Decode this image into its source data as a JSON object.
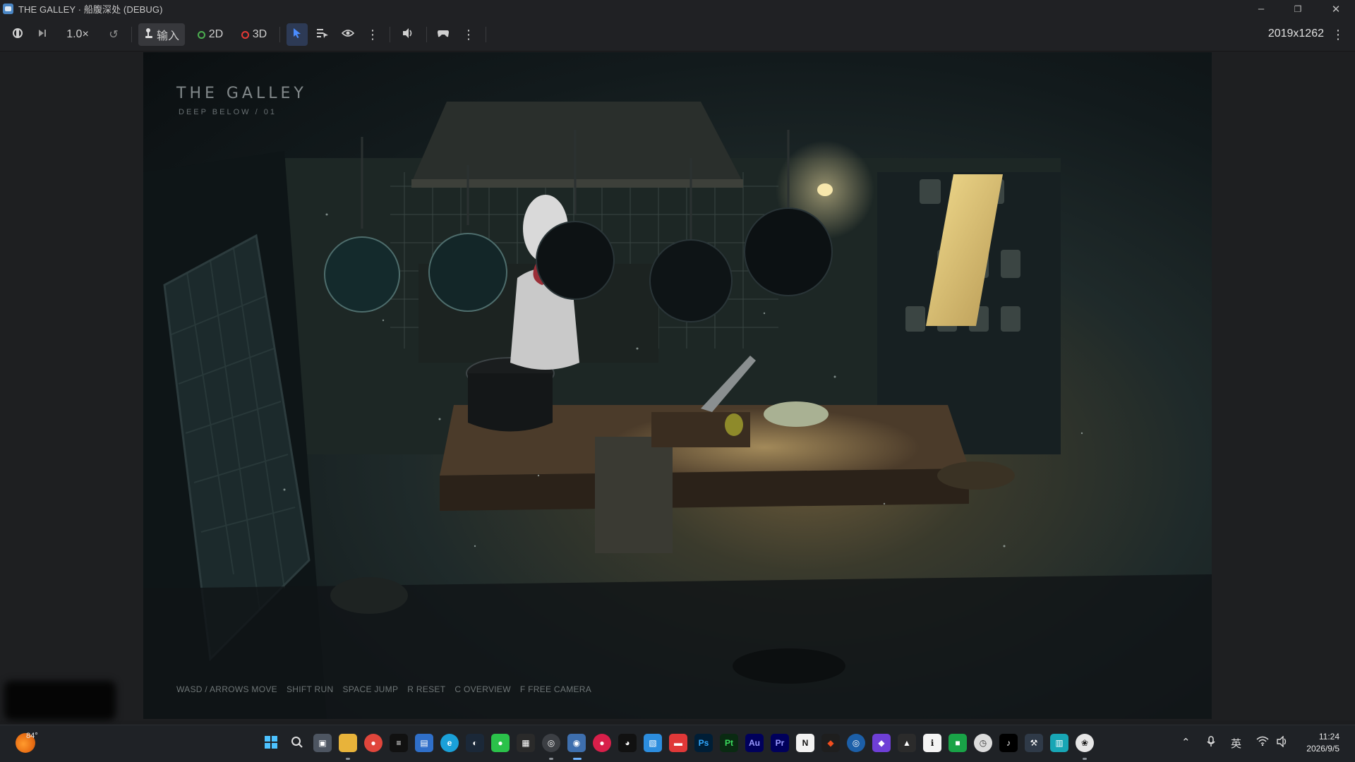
{
  "window": {
    "title": "THE GALLEY · 船腹深处 (DEBUG)",
    "minimize_icon": "minimize-icon",
    "restore_icon": "restore-icon",
    "close_icon": "close-icon"
  },
  "toolbar": {
    "speed_label": "1.0×",
    "input_label": "输入",
    "mode_2d_label": "2D",
    "mode_3d_label": "3D",
    "resolution": "2019x1262",
    "colors": {
      "dot_2d": "#4caf50",
      "dot_3d": "#e53935",
      "select_accent": "#4a8cff"
    }
  },
  "game": {
    "title": "THE GALLEY",
    "subtitle": "DEEP BELOW / 01",
    "controls": [
      "WASD / ARROWS  MOVE",
      "SHIFT  RUN",
      "SPACE  JUMP",
      "R  RESET",
      "C  OVERVIEW",
      "F  FREE CAMERA"
    ]
  },
  "taskbar": {
    "weather_temp": "84°",
    "ime_label": "英",
    "clock_time": "11:24",
    "clock_date": "2026/9/5",
    "app_labels": {
      "photoshop": "Ps",
      "audition": "Au",
      "premiere": "Pr",
      "premiere_lite": "Pt",
      "notion": "N"
    }
  }
}
